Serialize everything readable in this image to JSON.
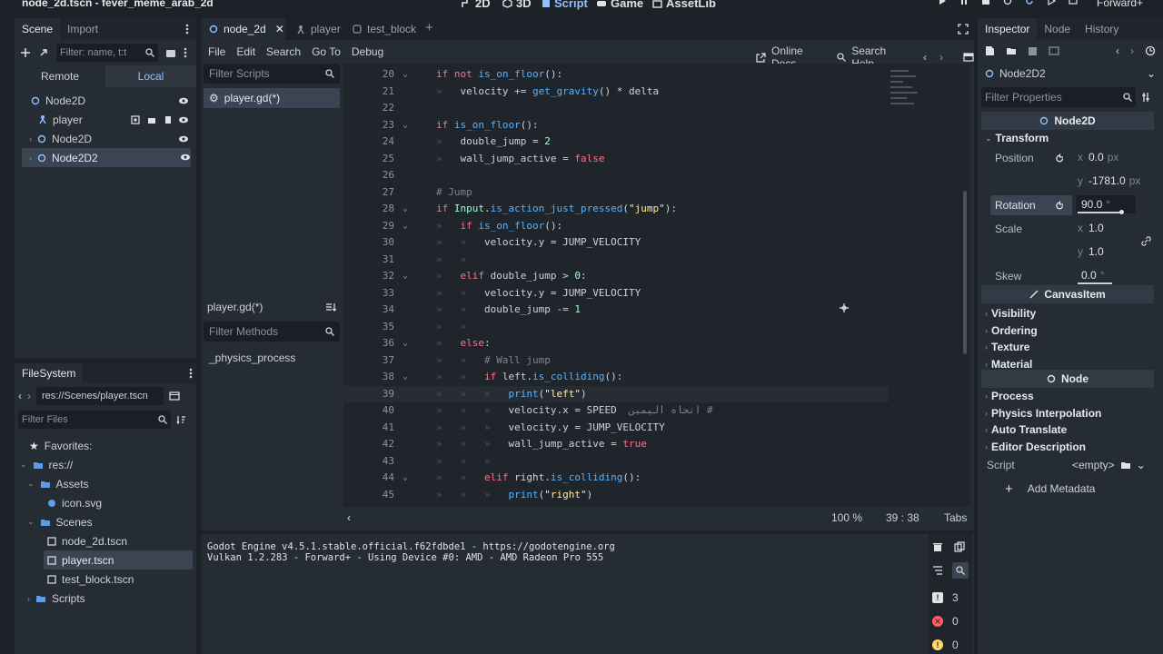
{
  "window": {
    "title": "node_2d.tscn - fever_meme_arab_2d"
  },
  "main_buttons": [
    "2D",
    "3D",
    "Script",
    "Game",
    "AssetLib"
  ],
  "renderer": "Forward+",
  "scene_dock": {
    "tabs": [
      "Scene",
      "Import"
    ],
    "filter_placeholder": "Filter: name, t:t",
    "remote_label": "Remote",
    "local_label": "Local",
    "tree": [
      "Node2D",
      "player",
      "Node2D",
      "Node2D2"
    ]
  },
  "filesystem": {
    "title": "FileSystem",
    "path": "res://Scenes/player.tscn",
    "filter_placeholder": "Filter Files",
    "items": [
      "Favorites:",
      "res://",
      "Assets",
      "icon.svg",
      "Scenes",
      "node_2d.tscn",
      "player.tscn",
      "test_block.tscn",
      "Scripts"
    ]
  },
  "editor_tabs": [
    "node_2d",
    "player",
    "test_block"
  ],
  "script_menu": [
    "File",
    "Edit",
    "Search",
    "Go To",
    "Debug"
  ],
  "script_right": {
    "online_docs": "Online Docs",
    "search_help": "Search Help"
  },
  "scripts_panel": {
    "filter_placeholder": "Filter Scripts",
    "scripts": [
      "player.gd(*)"
    ],
    "current": "player.gd(*)",
    "methods_placeholder": "Filter Methods",
    "methods": [
      "_physics_process"
    ]
  },
  "code_lines": [
    {
      "n": "20",
      "fold": true,
      "indent": 0,
      "tokens": [
        [
          "kw",
          "if "
        ],
        [
          "kw",
          "not "
        ],
        [
          "fn",
          "is_on_floor"
        ],
        [
          "txt",
          "():"
        ]
      ]
    },
    {
      "n": "21",
      "fold": false,
      "indent": 1,
      "tokens": [
        [
          "txt",
          "velocity += "
        ],
        [
          "fn",
          "get_gravity"
        ],
        [
          "txt",
          "() * delta"
        ]
      ]
    },
    {
      "n": "22",
      "fold": false,
      "indent": 0,
      "tokens": []
    },
    {
      "n": "23",
      "fold": true,
      "indent": 0,
      "tokens": [
        [
          "kw",
          "if "
        ],
        [
          "fn",
          "is_on_floor"
        ],
        [
          "txt",
          "():"
        ]
      ]
    },
    {
      "n": "24",
      "fold": false,
      "indent": 1,
      "tokens": [
        [
          "txt",
          "double_jump = "
        ],
        [
          "num",
          "2"
        ]
      ]
    },
    {
      "n": "25",
      "fold": false,
      "indent": 1,
      "tokens": [
        [
          "txt",
          "wall_jump_active = "
        ],
        [
          "kw",
          "false"
        ]
      ]
    },
    {
      "n": "26",
      "fold": false,
      "indent": 0,
      "tokens": []
    },
    {
      "n": "27",
      "fold": false,
      "indent": 0,
      "tokens": [
        [
          "cm",
          "# Jump"
        ]
      ]
    },
    {
      "n": "28",
      "fold": true,
      "indent": 0,
      "tokens": [
        [
          "kw",
          "if "
        ],
        [
          "cls",
          "Input"
        ],
        [
          "txt",
          "."
        ],
        [
          "fn",
          "is_action_just_pressed"
        ],
        [
          "txt",
          "("
        ],
        [
          "str",
          "\"jump\""
        ],
        [
          "txt",
          "):"
        ]
      ]
    },
    {
      "n": "29",
      "fold": true,
      "indent": 1,
      "tokens": [
        [
          "kw",
          "if "
        ],
        [
          "fn",
          "is_on_floor"
        ],
        [
          "txt",
          "():"
        ]
      ]
    },
    {
      "n": "30",
      "fold": false,
      "indent": 2,
      "tokens": [
        [
          "txt",
          "velocity.y = JUMP_VELOCITY"
        ]
      ]
    },
    {
      "n": "31",
      "fold": false,
      "indent": 2,
      "tokens": []
    },
    {
      "n": "32",
      "fold": true,
      "indent": 1,
      "tokens": [
        [
          "kw",
          "elif "
        ],
        [
          "txt",
          "double_jump > "
        ],
        [
          "num",
          "0"
        ],
        [
          "txt",
          ":"
        ]
      ]
    },
    {
      "n": "33",
      "fold": false,
      "indent": 2,
      "tokens": [
        [
          "txt",
          "velocity.y = JUMP_VELOCITY"
        ]
      ]
    },
    {
      "n": "34",
      "fold": false,
      "indent": 2,
      "tokens": [
        [
          "txt",
          "double_jump -= "
        ],
        [
          "num",
          "1"
        ]
      ]
    },
    {
      "n": "35",
      "fold": false,
      "indent": 2,
      "tokens": []
    },
    {
      "n": "36",
      "fold": true,
      "indent": 1,
      "tokens": [
        [
          "kw",
          "else"
        ],
        [
          "txt",
          ":"
        ]
      ]
    },
    {
      "n": "37",
      "fold": false,
      "indent": 2,
      "tokens": [
        [
          "cm",
          "# Wall jump"
        ]
      ]
    },
    {
      "n": "38",
      "fold": true,
      "indent": 2,
      "tokens": [
        [
          "kw",
          "if "
        ],
        [
          "txt",
          "left."
        ],
        [
          "fn",
          "is_colliding"
        ],
        [
          "txt",
          "():"
        ]
      ]
    },
    {
      "n": "39",
      "fold": false,
      "indent": 3,
      "tokens": [
        [
          "fn",
          "print"
        ],
        [
          "txt",
          "("
        ],
        [
          "str",
          "\"left\""
        ],
        [
          "txt",
          ")"
        ]
      ]
    },
    {
      "n": "40",
      "fold": false,
      "indent": 3,
      "tokens": [
        [
          "txt",
          "velocity.x = SPEED  "
        ],
        [
          "cm",
          "اتجاه اليمين #"
        ]
      ]
    },
    {
      "n": "41",
      "fold": false,
      "indent": 3,
      "tokens": [
        [
          "txt",
          "velocity.y = JUMP_VELOCITY"
        ]
      ]
    },
    {
      "n": "42",
      "fold": false,
      "indent": 3,
      "tokens": [
        [
          "txt",
          "wall_jump_active = "
        ],
        [
          "kw",
          "true"
        ]
      ]
    },
    {
      "n": "43",
      "fold": false,
      "indent": 3,
      "tokens": []
    },
    {
      "n": "44",
      "fold": true,
      "indent": 2,
      "tokens": [
        [
          "kw",
          "elif "
        ],
        [
          "txt",
          "right."
        ],
        [
          "fn",
          "is_colliding"
        ],
        [
          "txt",
          "():"
        ]
      ]
    },
    {
      "n": "45",
      "fold": false,
      "indent": 3,
      "tokens": [
        [
          "fn",
          "print"
        ],
        [
          "txt",
          "("
        ],
        [
          "str",
          "\"right\""
        ],
        [
          "txt",
          ")"
        ]
      ]
    }
  ],
  "status": {
    "zoom": "100 %",
    "cursor": "39 :  38",
    "indent": "Tabs"
  },
  "output": {
    "lines": [
      "Godot Engine v4.5.1.stable.official.f62fdbde1 - https://godotengine.org",
      "Vulkan 1.2.283 - Forward+ - Using Device #0: AMD - AMD Radeon Pro 555"
    ],
    "counts": {
      "messages": "3",
      "errors": "0",
      "warnings": "0"
    }
  },
  "inspector": {
    "tabs": [
      "Inspector",
      "Node",
      "History"
    ],
    "node_name": "Node2D2",
    "filter_placeholder": "Filter Properties",
    "class_header": "Node2D",
    "transform_label": "Transform",
    "position_label": "Position",
    "position_x": "0.0",
    "position_y": "-1781.0",
    "px": "px",
    "rotation_label": "Rotation",
    "rotation": "90.0",
    "degree": "°",
    "scale_label": "Scale",
    "scale_x": "1.0",
    "scale_y": "1.0",
    "skew_label": "Skew",
    "skew": "0.0",
    "canvas_item": "CanvasItem",
    "canvas_sections": [
      "Visibility",
      "Ordering",
      "Texture",
      "Material"
    ],
    "node_header": "Node",
    "node_sections": [
      "Process",
      "Physics Interpolation",
      "Auto Translate",
      "Editor Description"
    ],
    "script_label": "Script",
    "script_value": "<empty>",
    "add_metadata": "Add Metadata"
  }
}
